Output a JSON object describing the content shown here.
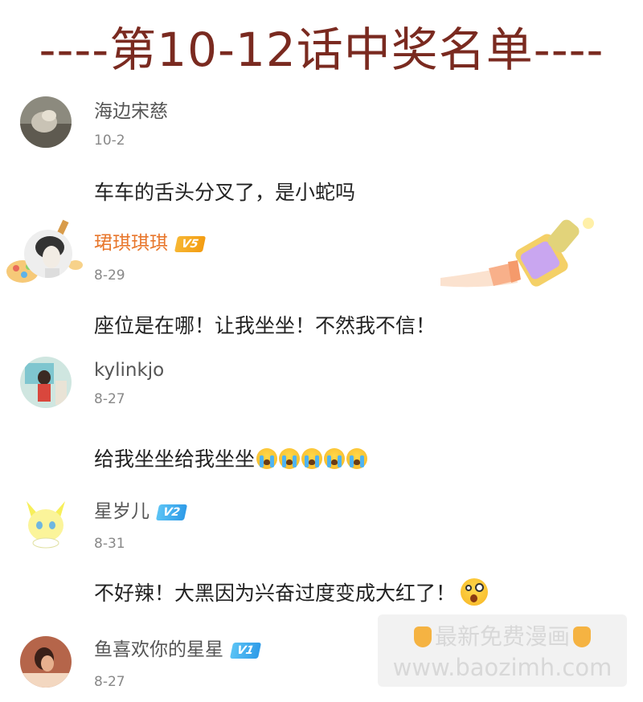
{
  "title": "----第10-12话中奖名单----",
  "comments": [
    {
      "user": "海边宋慈",
      "date": "10-2",
      "text": "车车的舌头分叉了，是小蛇吗"
    },
    {
      "user": "珺琪琪琪",
      "badge": "V5",
      "date": "8-29",
      "text": "座位是在哪！让我坐坐！不然我不信！"
    },
    {
      "user": "kylinkjo",
      "date": "8-27",
      "text": "给我坐坐给我坐坐",
      "emoji": "loudly-crying-face x5"
    },
    {
      "user": "星岁儿",
      "badge": "V2",
      "date": "8-31",
      "text": "不好辣！大黑因为兴奋过度变成大红了！",
      "emoji": "astonished-face"
    },
    {
      "user": "鱼喜欢你的星星",
      "badge": "V1",
      "date": "8-27"
    }
  ],
  "watermark": {
    "line1": "最新免费漫画",
    "line2": "www.baozimh.com",
    "icon": "pointing-down-hand-icon"
  },
  "colors": {
    "title": "#7a2a20",
    "vip_name": "#e8772c",
    "badge_gold": "#f5a623",
    "badge_blue": "#3aa7ec"
  }
}
